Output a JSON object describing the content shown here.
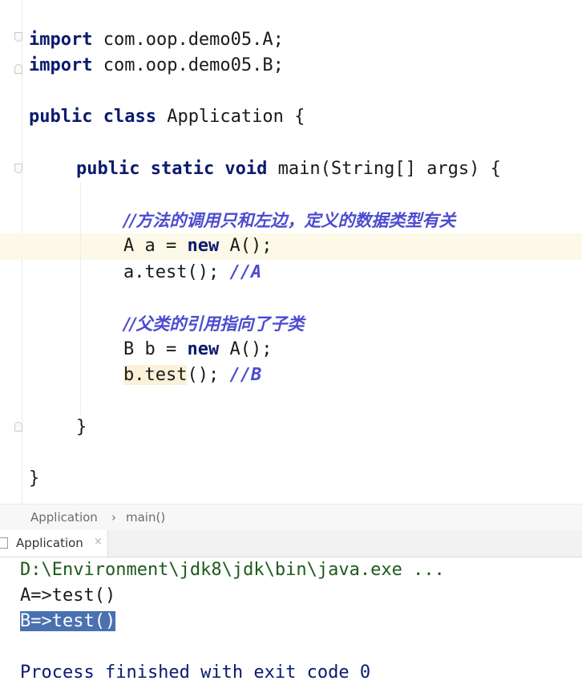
{
  "editor": {
    "import_keyword": "import",
    "import_a": " com.oop.demo05.A;",
    "import_b": " com.oop.demo05.B;",
    "class_kw": "public class",
    "class_name": " Application {",
    "method_kw": "public static void",
    "method_sig": " main(String[] args) {",
    "comment1": "//方法的调用只和左边，定义的数据类型有关",
    "line_a1_pre": "A a = ",
    "new_kw": "new",
    "line_a1_post": " A();",
    "line_a2_code": "a.test(); ",
    "line_a2_comment": "//A",
    "comment2": "//父类的引用指向了子类",
    "line_b1_pre": "B b = ",
    "line_b1_post": " A();",
    "line_b2_hl": "b.test",
    "line_b2_rest": "(); ",
    "line_b2_comment": "//B",
    "close_method": "}",
    "close_class": "}"
  },
  "breadcrumb": {
    "class": "Application",
    "separator": "›",
    "method": "main()"
  },
  "run_tab": {
    "label": "Application",
    "close": "×"
  },
  "console": {
    "cmd": "D:\\Environment\\jdk8\\jdk\\bin\\java.exe ...",
    "out1": "A=>test()",
    "out2": "B=>test()",
    "exit": "Process finished with exit code 0"
  }
}
